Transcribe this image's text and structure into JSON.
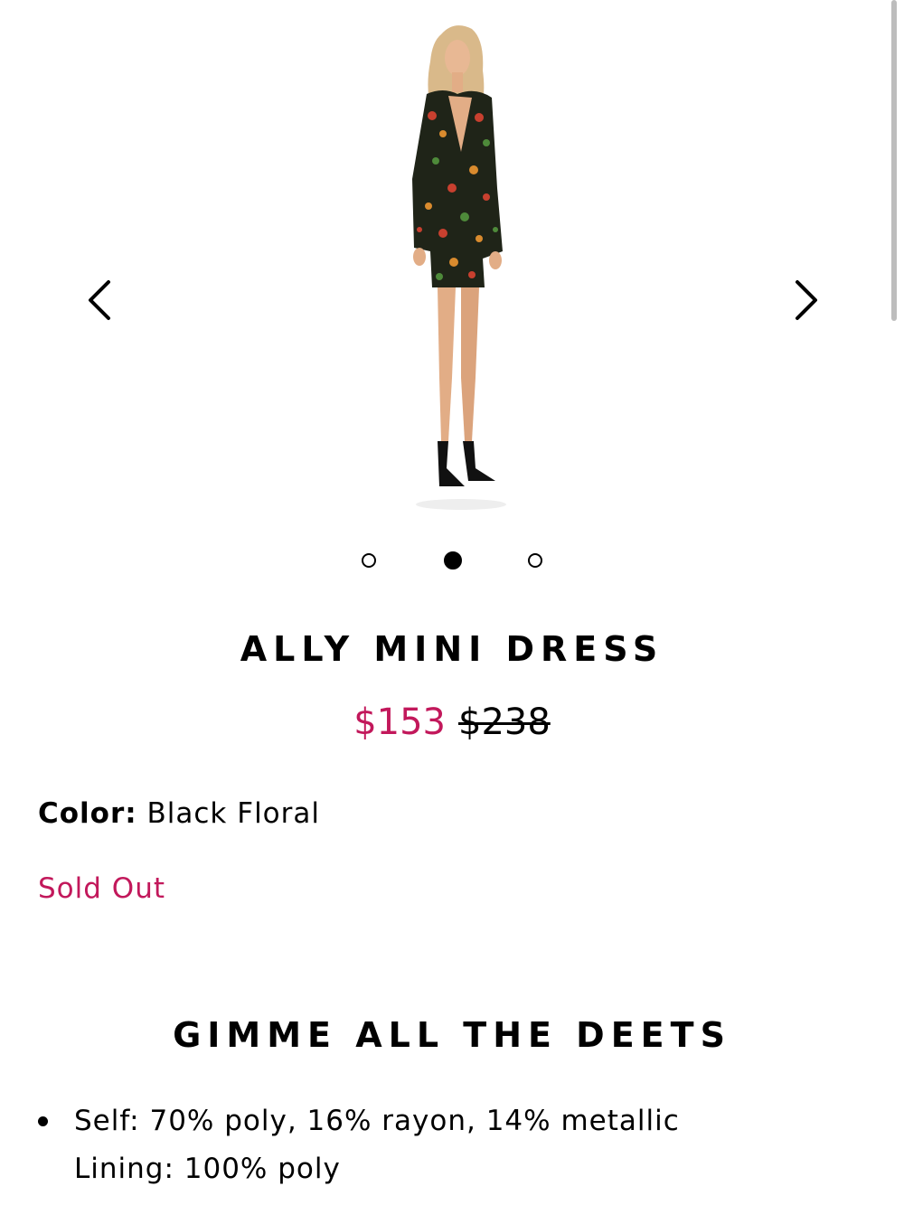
{
  "gallery": {
    "prev_icon": "chevron-left-icon",
    "next_icon": "chevron-right-icon",
    "image_subject": "model wearing floral blazer mini dress",
    "slide_count": 3,
    "active_slide": 2
  },
  "product": {
    "title": "ALLY MINI DRESS",
    "sale_price": "$153",
    "original_price": "$238",
    "color_label": "Color:",
    "color_value": "Black Floral",
    "availability": "Sold Out"
  },
  "details": {
    "heading": "GIMME ALL THE DEETS",
    "items": [
      {
        "line1": "Self: 70% poly, 16% rayon, 14% metallic",
        "line2": "Lining: 100% poly"
      }
    ]
  },
  "colors": {
    "accent": "#c2185b",
    "text": "#000000",
    "background": "#ffffff"
  }
}
